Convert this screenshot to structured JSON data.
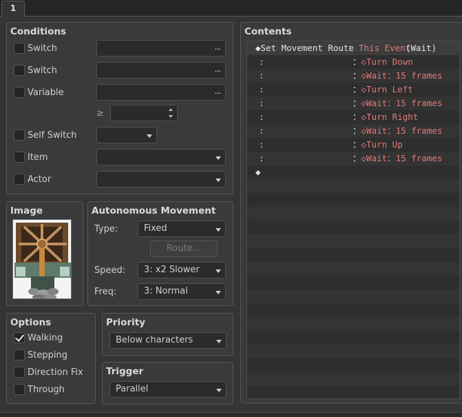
{
  "tab": {
    "label": "1"
  },
  "conditions": {
    "title": "Conditions",
    "switch1": "Switch",
    "switch2": "Switch",
    "variable": "Variable",
    "gte": "≥",
    "self_switch": "Self Switch",
    "item": "Item",
    "actor": "Actor",
    "ellipsis": "..."
  },
  "image": {
    "title": "Image"
  },
  "autonomous": {
    "title": "Autonomous Movement",
    "type_label": "Type:",
    "type_value": "Fixed",
    "route_button": "Route...",
    "speed_label": "Speed:",
    "speed_value": "3: x2 Slower",
    "freq_label": "Freq:",
    "freq_value": "3: Normal"
  },
  "options": {
    "title": "Options",
    "items": [
      {
        "label": "Walking",
        "checked": true
      },
      {
        "label": "Stepping",
        "checked": false
      },
      {
        "label": "Direction Fix",
        "checked": false
      },
      {
        "label": "Through",
        "checked": false
      }
    ]
  },
  "priority": {
    "title": "Priority",
    "value": "Below characters"
  },
  "trigger": {
    "title": "Trigger",
    "value": "Parallel"
  },
  "contents": {
    "title": "Contents",
    "lines": [
      {
        "head": "◆Set Movement Route",
        "sep": "：",
        "target": "This Event",
        "extra": " (Wait)"
      },
      {
        "colon": ":",
        "sep": "：",
        "text": "◇Turn Down"
      },
      {
        "colon": ":",
        "sep": "：",
        "text": "◇Wait",
        "sep2": "：",
        "value": "15 frames"
      },
      {
        "colon": ":",
        "sep": "：",
        "text": "◇Turn Left"
      },
      {
        "colon": ":",
        "sep": "：",
        "text": "◇Wait",
        "sep2": "：",
        "value": "15 frames"
      },
      {
        "colon": ":",
        "sep": "：",
        "text": "◇Turn Right"
      },
      {
        "colon": ":",
        "sep": "：",
        "text": "◇Wait",
        "sep2": "：",
        "value": "15 frames"
      },
      {
        "colon": ":",
        "sep": "：",
        "text": "◇Turn Up"
      },
      {
        "colon": ":",
        "sep": "：",
        "text": "◇Wait",
        "sep2": "：",
        "value": "15 frames"
      },
      {
        "head": "◆"
      }
    ]
  }
}
